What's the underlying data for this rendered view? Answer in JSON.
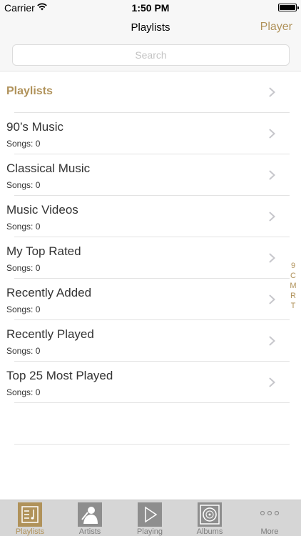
{
  "status_bar": {
    "carrier": "Carrier",
    "time": "1:50 PM"
  },
  "nav": {
    "title": "Playlists",
    "right_button": "Player",
    "search_placeholder": "Search"
  },
  "section_header": "Playlists",
  "playlists": [
    {
      "title": "90’s Music",
      "songs": "Songs: 0"
    },
    {
      "title": "Classical Music",
      "songs": "Songs: 0"
    },
    {
      "title": "Music Videos",
      "songs": "Songs: 0"
    },
    {
      "title": "My Top Rated",
      "songs": "Songs: 0"
    },
    {
      "title": "Recently Added",
      "songs": "Songs: 0"
    },
    {
      "title": "Recently Played",
      "songs": "Songs: 0"
    },
    {
      "title": "Top 25 Most Played",
      "songs": "Songs: 0"
    }
  ],
  "index_letters": [
    "9",
    "C",
    "M",
    "R",
    "T"
  ],
  "tabs": [
    {
      "label": "Playlists",
      "icon": "playlist-icon",
      "active": true
    },
    {
      "label": "Artists",
      "icon": "artist-icon",
      "active": false
    },
    {
      "label": "Playing",
      "icon": "play-icon",
      "active": false
    },
    {
      "label": "Albums",
      "icon": "album-icon",
      "active": false
    },
    {
      "label": "More",
      "icon": "more-icon",
      "active": false
    }
  ],
  "colors": {
    "accent": "#b0925a",
    "tab_inactive": "#8e8e8e",
    "bars": "#f7f7f7"
  }
}
